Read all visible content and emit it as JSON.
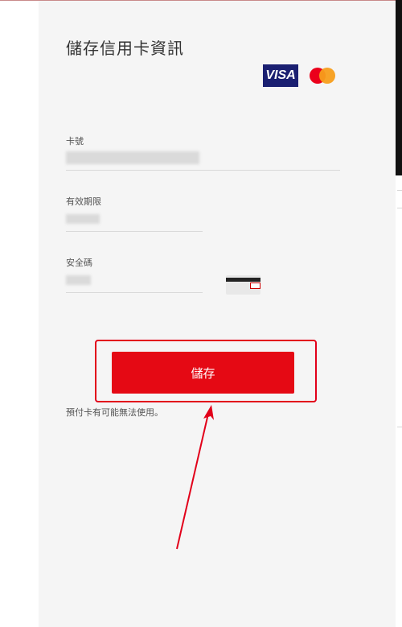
{
  "form": {
    "title": "儲存信用卡資訊",
    "brands": [
      "VISA",
      "mastercard"
    ],
    "card_number_label": "卡號",
    "expiry_label": "有效期限",
    "cvv_label": "安全碼",
    "save_label": "儲存",
    "note": "預付卡有可能無法使用。"
  },
  "colors": {
    "accent": "#e50914",
    "highlight": "#e2001a",
    "visa_blue": "#1a1f71"
  }
}
